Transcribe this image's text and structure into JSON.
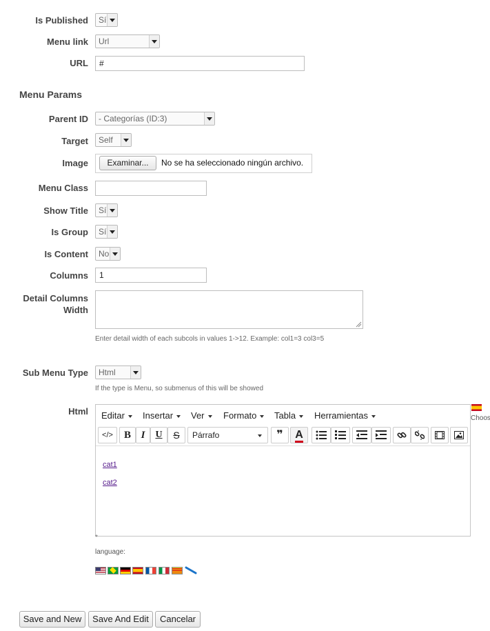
{
  "fields": {
    "is_published": {
      "label": "Is Published",
      "value": "Sí"
    },
    "menu_link": {
      "label": "Menu link",
      "value": "Url"
    },
    "url": {
      "label": "URL",
      "value": "#"
    },
    "section_title": "Menu Params",
    "parent_id": {
      "label": "Parent ID",
      "value": "- Categorías (ID:3)"
    },
    "target": {
      "label": "Target",
      "value": "Self"
    },
    "image": {
      "label": "Image",
      "button": "Examinar...",
      "status": "No se ha seleccionado ningún archivo."
    },
    "menu_class": {
      "label": "Menu Class",
      "value": ""
    },
    "show_title": {
      "label": "Show Title",
      "value": "Sí"
    },
    "is_group": {
      "label": "Is Group",
      "value": "Sí"
    },
    "is_content": {
      "label": "Is Content",
      "value": "No"
    },
    "columns": {
      "label": "Columns",
      "value": "1"
    },
    "detail_columns": {
      "label_line1": "Detail Columns",
      "label_line2": "Width",
      "hint": "Enter detail width of each subcols in values 1->12. Example: col1=3 col3=5"
    },
    "sub_menu_type": {
      "label": "Sub Menu Type",
      "value": "Html",
      "hint": "If the type is Menu, so submenus of this will be showed"
    },
    "html": {
      "label": "Html"
    }
  },
  "editor": {
    "menus": [
      "Editar",
      "Insertar",
      "Ver",
      "Formato",
      "Tabla",
      "Herramientas"
    ],
    "code_label": "</>",
    "bold": "B",
    "italic": "I",
    "underline": "U",
    "strike": "S",
    "format_value": "Párrafo",
    "quote": "❞",
    "text_color": "A",
    "content_links": [
      "cat1",
      "cat2"
    ],
    "status_mark": "*",
    "lang_choose": "Choos",
    "icons": [
      "code-icon",
      "bold-icon",
      "italic-icon",
      "underline-icon",
      "strikethrough-icon",
      "blockquote-icon",
      "text-color-icon",
      "bullet-list-icon",
      "numbered-list-icon",
      "outdent-icon",
      "indent-icon",
      "link-icon",
      "unlink-icon",
      "media-icon",
      "image-icon"
    ]
  },
  "language": {
    "label": "language:",
    "flags": [
      "us",
      "br",
      "de",
      "es",
      "fr",
      "it",
      "ca",
      "link"
    ]
  },
  "actions": {
    "save_new": "Save and New",
    "save_edit": "Save And Edit",
    "cancel": "Cancelar"
  }
}
